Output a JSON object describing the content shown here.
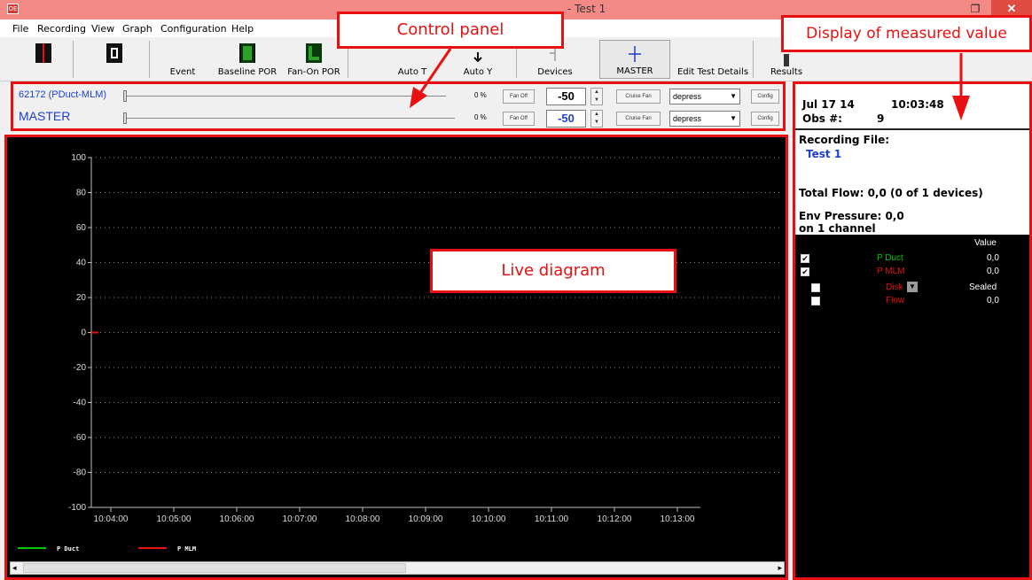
{
  "window": {
    "title": " - Test 1",
    "app_icon": "OE",
    "restore_icon": "restore-icon",
    "close_icon": "close-icon",
    "restore_glyph": "❐",
    "close_glyph": "✕"
  },
  "menu": {
    "items": [
      "File",
      "Recording",
      "View",
      "Graph",
      "Configuration",
      "Help"
    ]
  },
  "toolbar": {
    "buttons": [
      {
        "label": "",
        "icon": "stop-record-icon"
      },
      {
        "label": "",
        "icon": "pause-icon"
      },
      {
        "label": "Event",
        "icon": ""
      },
      {
        "label": "Baseline POR",
        "icon": "baseline-icon"
      },
      {
        "label": "Fan-On POR",
        "icon": "fan-on-icon"
      },
      {
        "label": "Auto T",
        "icon": "auto-t-icon"
      },
      {
        "label": "Auto Y",
        "icon": "auto-y-icon"
      },
      {
        "label": "Devices",
        "icon": "devices-icon"
      },
      {
        "label": "MASTER",
        "icon": "master-icon"
      },
      {
        "label": "Edit Test Details",
        "icon": ""
      },
      {
        "label": "Results",
        "icon": "results-icon"
      }
    ]
  },
  "control_panel": {
    "rows": [
      {
        "device": "62172 (PDuct-MLM)",
        "percent": "0 %",
        "fan_button": "Fan Off",
        "value": "-50",
        "cruise_button": "Cruise Fan",
        "mode": "depress",
        "config_button": "Config"
      },
      {
        "device": "MASTER",
        "percent": "0 %",
        "fan_button": "Fan Off",
        "value": "-50",
        "cruise_button": "Cruise Fan",
        "mode": "depress",
        "config_button": "Config"
      }
    ]
  },
  "chart_data": {
    "type": "line",
    "title": "",
    "xlabel": "",
    "ylabel": "",
    "ylim": [
      -100,
      100
    ],
    "yticks": [
      "100",
      "80",
      "60",
      "40",
      "20",
      "0",
      "-20",
      "-40",
      "-60",
      "-80",
      "-100"
    ],
    "xticks": [
      "10:04:00",
      "10:05:00",
      "10:06:00",
      "10:07:00",
      "10:08:00",
      "10:09:00",
      "10:10:00",
      "10:11:00",
      "10:12:00",
      "10:13:00"
    ],
    "grid": true,
    "series": [
      {
        "name": "P Duct",
        "color": "#00c800",
        "values": [
          0
        ]
      },
      {
        "name": "P MLM",
        "color": "#e81010",
        "values": [
          0
        ]
      }
    ],
    "legend": "bottom-left"
  },
  "display": {
    "date": "Jul 17 14",
    "time": "10:03:48",
    "obs_label": "Obs #:",
    "obs_value": "9",
    "recording_file_label": "Recording File:",
    "recording_file_value": "Test 1",
    "total_flow": "Total Flow: 0,0 (0 of 1 devices)",
    "env_pressure": "Env Pressure: 0,0",
    "env_channel": "on 1 channel",
    "value_header": "Value",
    "channels": [
      {
        "name": "P Duct",
        "color": "#00c800",
        "value": "0,0",
        "checked": true
      },
      {
        "name": "P MLM",
        "color": "#e81010",
        "value": "0,0",
        "checked": true
      },
      {
        "name": "Disk",
        "color": "#e81010",
        "value": "Sealed",
        "checked": false
      },
      {
        "name": "Flow",
        "color": "#e81010",
        "value": "0,0",
        "checked": false
      }
    ]
  },
  "annotations": {
    "control_panel": "Control panel",
    "display": "Display of measured value",
    "live_diagram": "Live diagram"
  },
  "scroll": {
    "left_arrow": "◂",
    "right_arrow": "▸"
  }
}
